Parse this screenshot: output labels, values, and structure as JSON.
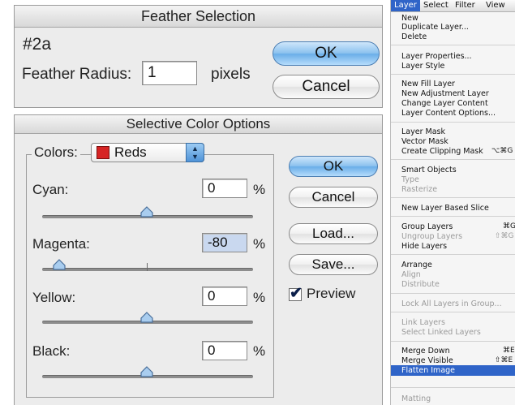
{
  "feather_dialog": {
    "title": "Feather Selection",
    "step_label": "#2a",
    "radius_label": "Feather Radius:",
    "radius_value": "1",
    "units": "pixels",
    "ok": "OK",
    "cancel": "Cancel"
  },
  "selective_dialog": {
    "title": "Selective Color Options",
    "colors_label": "Colors:",
    "colors_value": "Reds",
    "swatch_color": "#d62424",
    "ok": "OK",
    "cancel": "Cancel",
    "load": "Load...",
    "save": "Save...",
    "preview": "Preview",
    "preview_checked": true,
    "sliders": [
      {
        "label": "Cyan:",
        "value": "0",
        "unit": "%"
      },
      {
        "label": "Magenta:",
        "value": "-80",
        "unit": "%"
      },
      {
        "label": "Yellow:",
        "value": "0",
        "unit": "%"
      },
      {
        "label": "Black:",
        "value": "0",
        "unit": "%"
      }
    ]
  },
  "layer_menu": {
    "menubar": [
      "Layer",
      "Select",
      "Filter",
      "View"
    ],
    "items": [
      {
        "label": "New",
        "disabled": false
      },
      {
        "label": "Duplicate Layer...",
        "disabled": false
      },
      {
        "label": "Delete",
        "disabled": false
      },
      {
        "label": "Layer Properties...",
        "disabled": false
      },
      {
        "label": "Layer Style",
        "disabled": false
      },
      {
        "label": "New Fill Layer",
        "disabled": false
      },
      {
        "label": "New Adjustment Layer",
        "disabled": false
      },
      {
        "label": "Change Layer Content",
        "disabled": false
      },
      {
        "label": "Layer Content Options...",
        "disabled": false
      },
      {
        "label": "Layer Mask",
        "disabled": false
      },
      {
        "label": "Vector Mask",
        "disabled": false
      },
      {
        "label": "Create Clipping Mask",
        "disabled": false,
        "shortcut": "⌥⌘G"
      },
      {
        "label": "Smart Objects",
        "disabled": false
      },
      {
        "label": "Type",
        "disabled": true
      },
      {
        "label": "Rasterize",
        "disabled": true
      },
      {
        "label": "New Layer Based Slice",
        "disabled": false
      },
      {
        "label": "Group Layers",
        "disabled": false,
        "shortcut": "⌘G"
      },
      {
        "label": "Ungroup Layers",
        "disabled": true,
        "shortcut": "⇧⌘G"
      },
      {
        "label": "Hide Layers",
        "disabled": false
      },
      {
        "label": "Arrange",
        "disabled": false
      },
      {
        "label": "Align",
        "disabled": true
      },
      {
        "label": "Distribute",
        "disabled": true
      },
      {
        "label": "Lock All Layers in Group...",
        "disabled": true
      },
      {
        "label": "Link Layers",
        "disabled": true
      },
      {
        "label": "Select Linked Layers",
        "disabled": true
      },
      {
        "label": "Merge Down",
        "disabled": false,
        "shortcut": "⌘E"
      },
      {
        "label": "Merge Visible",
        "disabled": false,
        "shortcut": "⇧⌘E"
      },
      {
        "label": "Flatten Image",
        "disabled": false,
        "highlighted": true
      },
      {
        "label": "Matting",
        "disabled": true
      }
    ]
  }
}
